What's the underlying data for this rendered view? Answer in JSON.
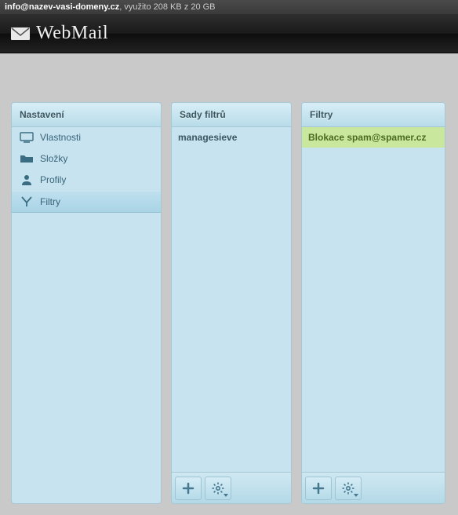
{
  "topbar": {
    "email": "info@nazev-vasi-domeny.cz",
    "usage": ", využito 208 KB z 20 GB"
  },
  "brand": {
    "name": "WebMail"
  },
  "panels": {
    "settings": {
      "title": "Nastavení",
      "items": [
        {
          "label": "Vlastnosti",
          "icon": "monitor-icon"
        },
        {
          "label": "Složky",
          "icon": "folder-icon"
        },
        {
          "label": "Profily",
          "icon": "person-icon"
        },
        {
          "label": "Filtry",
          "icon": "filter-icon",
          "selected": true
        }
      ]
    },
    "filtersets": {
      "title": "Sady filtrů",
      "items": [
        {
          "label": "managesieve"
        }
      ]
    },
    "filters": {
      "title": "Filtry",
      "items": [
        {
          "label": "Blokace spam@spamer.cz",
          "highlight": "green"
        }
      ]
    }
  }
}
